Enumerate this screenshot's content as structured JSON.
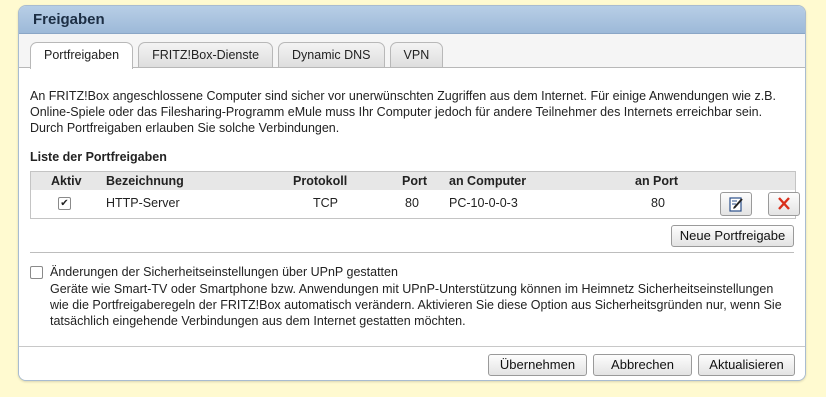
{
  "panel": {
    "title": "Freigaben"
  },
  "tabs": [
    {
      "label": "Portfreigaben",
      "active": true
    },
    {
      "label": "FRITZ!Box-Dienste",
      "active": false
    },
    {
      "label": "Dynamic DNS",
      "active": false
    },
    {
      "label": "VPN",
      "active": false
    }
  ],
  "intro": "An FRITZ!Box angeschlossene Computer sind sicher vor unerwünschten Zugriffen aus dem Internet. Für einige Anwendungen wie z.B. Online-Spiele oder das Filesharing-Programm eMule muss Ihr Computer jedoch für andere Teilnehmer des Internets erreichbar sein. Durch Portfreigaben erlauben Sie solche Verbindungen.",
  "list": {
    "title": "Liste der Portfreigaben",
    "headers": {
      "aktiv": "Aktiv",
      "bezeichnung": "Bezeichnung",
      "protokoll": "Protokoll",
      "port": "Port",
      "computer": "an Computer",
      "anport": "an Port"
    },
    "rows": [
      {
        "aktiv": true,
        "bezeichnung": "HTTP-Server",
        "protokoll": "TCP",
        "port": "80",
        "computer": "PC-10-0-0-3",
        "anport": "80"
      }
    ],
    "new_button": "Neue Portfreigabe"
  },
  "upnp": {
    "checked": false,
    "label": "Änderungen der Sicherheitseinstellungen über UPnP gestatten",
    "description": "Geräte wie Smart-TV oder Smartphone bzw. Anwendungen mit UPnP-Unterstützung können im Heimnetz Sicherheitseinstellungen wie die Portfreigaberegeln der FRITZ!Box automatisch verändern. Aktivieren Sie diese Option aus Sicherheitsgründen nur, wenn Sie tatsächlich eingehende Verbindungen aus dem Internet gestatten möchten."
  },
  "footer": {
    "apply": "Übernehmen",
    "cancel": "Abbrechen",
    "refresh": "Aktualisieren"
  },
  "colors": {
    "header": "#a9c3e0",
    "delete": "#d9301c"
  }
}
